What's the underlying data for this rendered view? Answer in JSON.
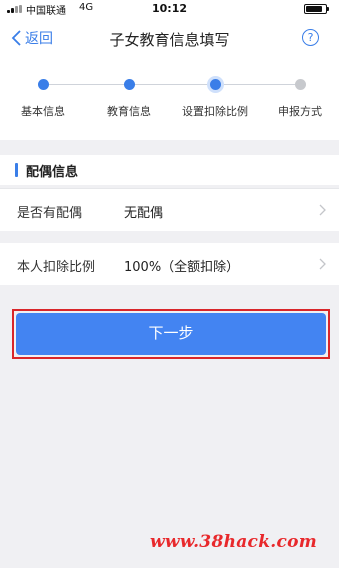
{
  "status_bar": {
    "carrier": "中国联通",
    "network": "4G",
    "time": "10:12",
    "battery_level": 0.85
  },
  "nav": {
    "back_label": "返回",
    "title": "子女教育信息填写",
    "help_symbol": "?"
  },
  "steps": [
    {
      "label": "基本信息",
      "state": "done"
    },
    {
      "label": "教育信息",
      "state": "done"
    },
    {
      "label": "设置扣除比例",
      "state": "current"
    },
    {
      "label": "申报方式",
      "state": "pending"
    }
  ],
  "section": {
    "title": "配偶信息"
  },
  "rows": {
    "spouse": {
      "label": "是否有配偶",
      "value": "无配偶"
    },
    "ratio": {
      "label": "本人扣除比例",
      "value": "100%（全额扣除）"
    }
  },
  "next_button": {
    "label": "下一步"
  },
  "watermark": "www.38hack.com",
  "colors": {
    "accent": "#3a7ee8",
    "button": "#4384f2",
    "highlight": "#d9262a",
    "background": "#f0f0f3"
  }
}
